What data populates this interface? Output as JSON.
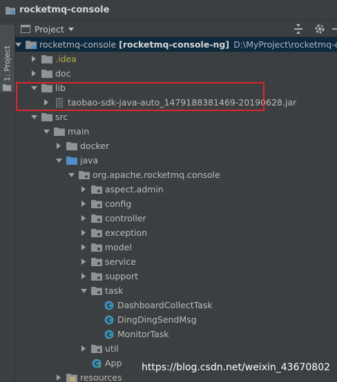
{
  "window": {
    "title": "rocketmq-console"
  },
  "sidebar": {
    "tab_label": "1: Project"
  },
  "toolbar": {
    "view_label": "Project"
  },
  "tree": [
    {
      "depth": 0,
      "expanded": true,
      "type": "module",
      "label": "rocketmq-console",
      "extra": "[rocketmq-console-ng]",
      "path": "D:\\MyProject\\rocketmq-exter",
      "selected": true
    },
    {
      "depth": 1,
      "expanded": false,
      "type": "folder",
      "label": ".idea",
      "style": "idea"
    },
    {
      "depth": 1,
      "expanded": false,
      "type": "folder",
      "label": "doc"
    },
    {
      "depth": 1,
      "expanded": true,
      "type": "folder",
      "label": "lib"
    },
    {
      "depth": 2,
      "expanded": false,
      "type": "jar",
      "label": "taobao-sdk-java-auto_1479188381469-20190628.jar"
    },
    {
      "depth": 1,
      "expanded": true,
      "type": "folder",
      "label": "src"
    },
    {
      "depth": 2,
      "expanded": true,
      "type": "folder",
      "label": "main"
    },
    {
      "depth": 3,
      "expanded": false,
      "type": "folder",
      "label": "docker"
    },
    {
      "depth": 3,
      "expanded": true,
      "type": "source",
      "label": "java"
    },
    {
      "depth": 4,
      "expanded": true,
      "type": "package",
      "label": "org.apache.rocketmq.console"
    },
    {
      "depth": 5,
      "expanded": false,
      "type": "package",
      "label": "aspect.admin"
    },
    {
      "depth": 5,
      "expanded": false,
      "type": "package",
      "label": "config"
    },
    {
      "depth": 5,
      "expanded": false,
      "type": "package",
      "label": "controller"
    },
    {
      "depth": 5,
      "expanded": false,
      "type": "package",
      "label": "exception"
    },
    {
      "depth": 5,
      "expanded": false,
      "type": "package",
      "label": "model"
    },
    {
      "depth": 5,
      "expanded": false,
      "type": "package",
      "label": "service"
    },
    {
      "depth": 5,
      "expanded": false,
      "type": "package",
      "label": "support"
    },
    {
      "depth": 5,
      "expanded": true,
      "type": "package",
      "label": "task"
    },
    {
      "depth": 6,
      "leaf": true,
      "type": "class",
      "label": "DashboardCollectTask"
    },
    {
      "depth": 6,
      "leaf": true,
      "type": "class",
      "label": "DingDingSendMsg"
    },
    {
      "depth": 6,
      "leaf": true,
      "type": "class",
      "label": "MonitorTask"
    },
    {
      "depth": 5,
      "expanded": false,
      "type": "package",
      "label": "util"
    },
    {
      "depth": 5,
      "leaf": true,
      "type": "app-class",
      "label": "App"
    },
    {
      "depth": 3,
      "expanded": false,
      "type": "resources",
      "label": "resources"
    }
  ],
  "watermark": "https://blog.csdn.net/weixin_43670802",
  "colors": {
    "folder": "#8f9397",
    "source_folder": "#4e8fc7",
    "class_icon": "#3d8fb3",
    "highlight": "#e0262b",
    "selection": "#0d293e"
  }
}
